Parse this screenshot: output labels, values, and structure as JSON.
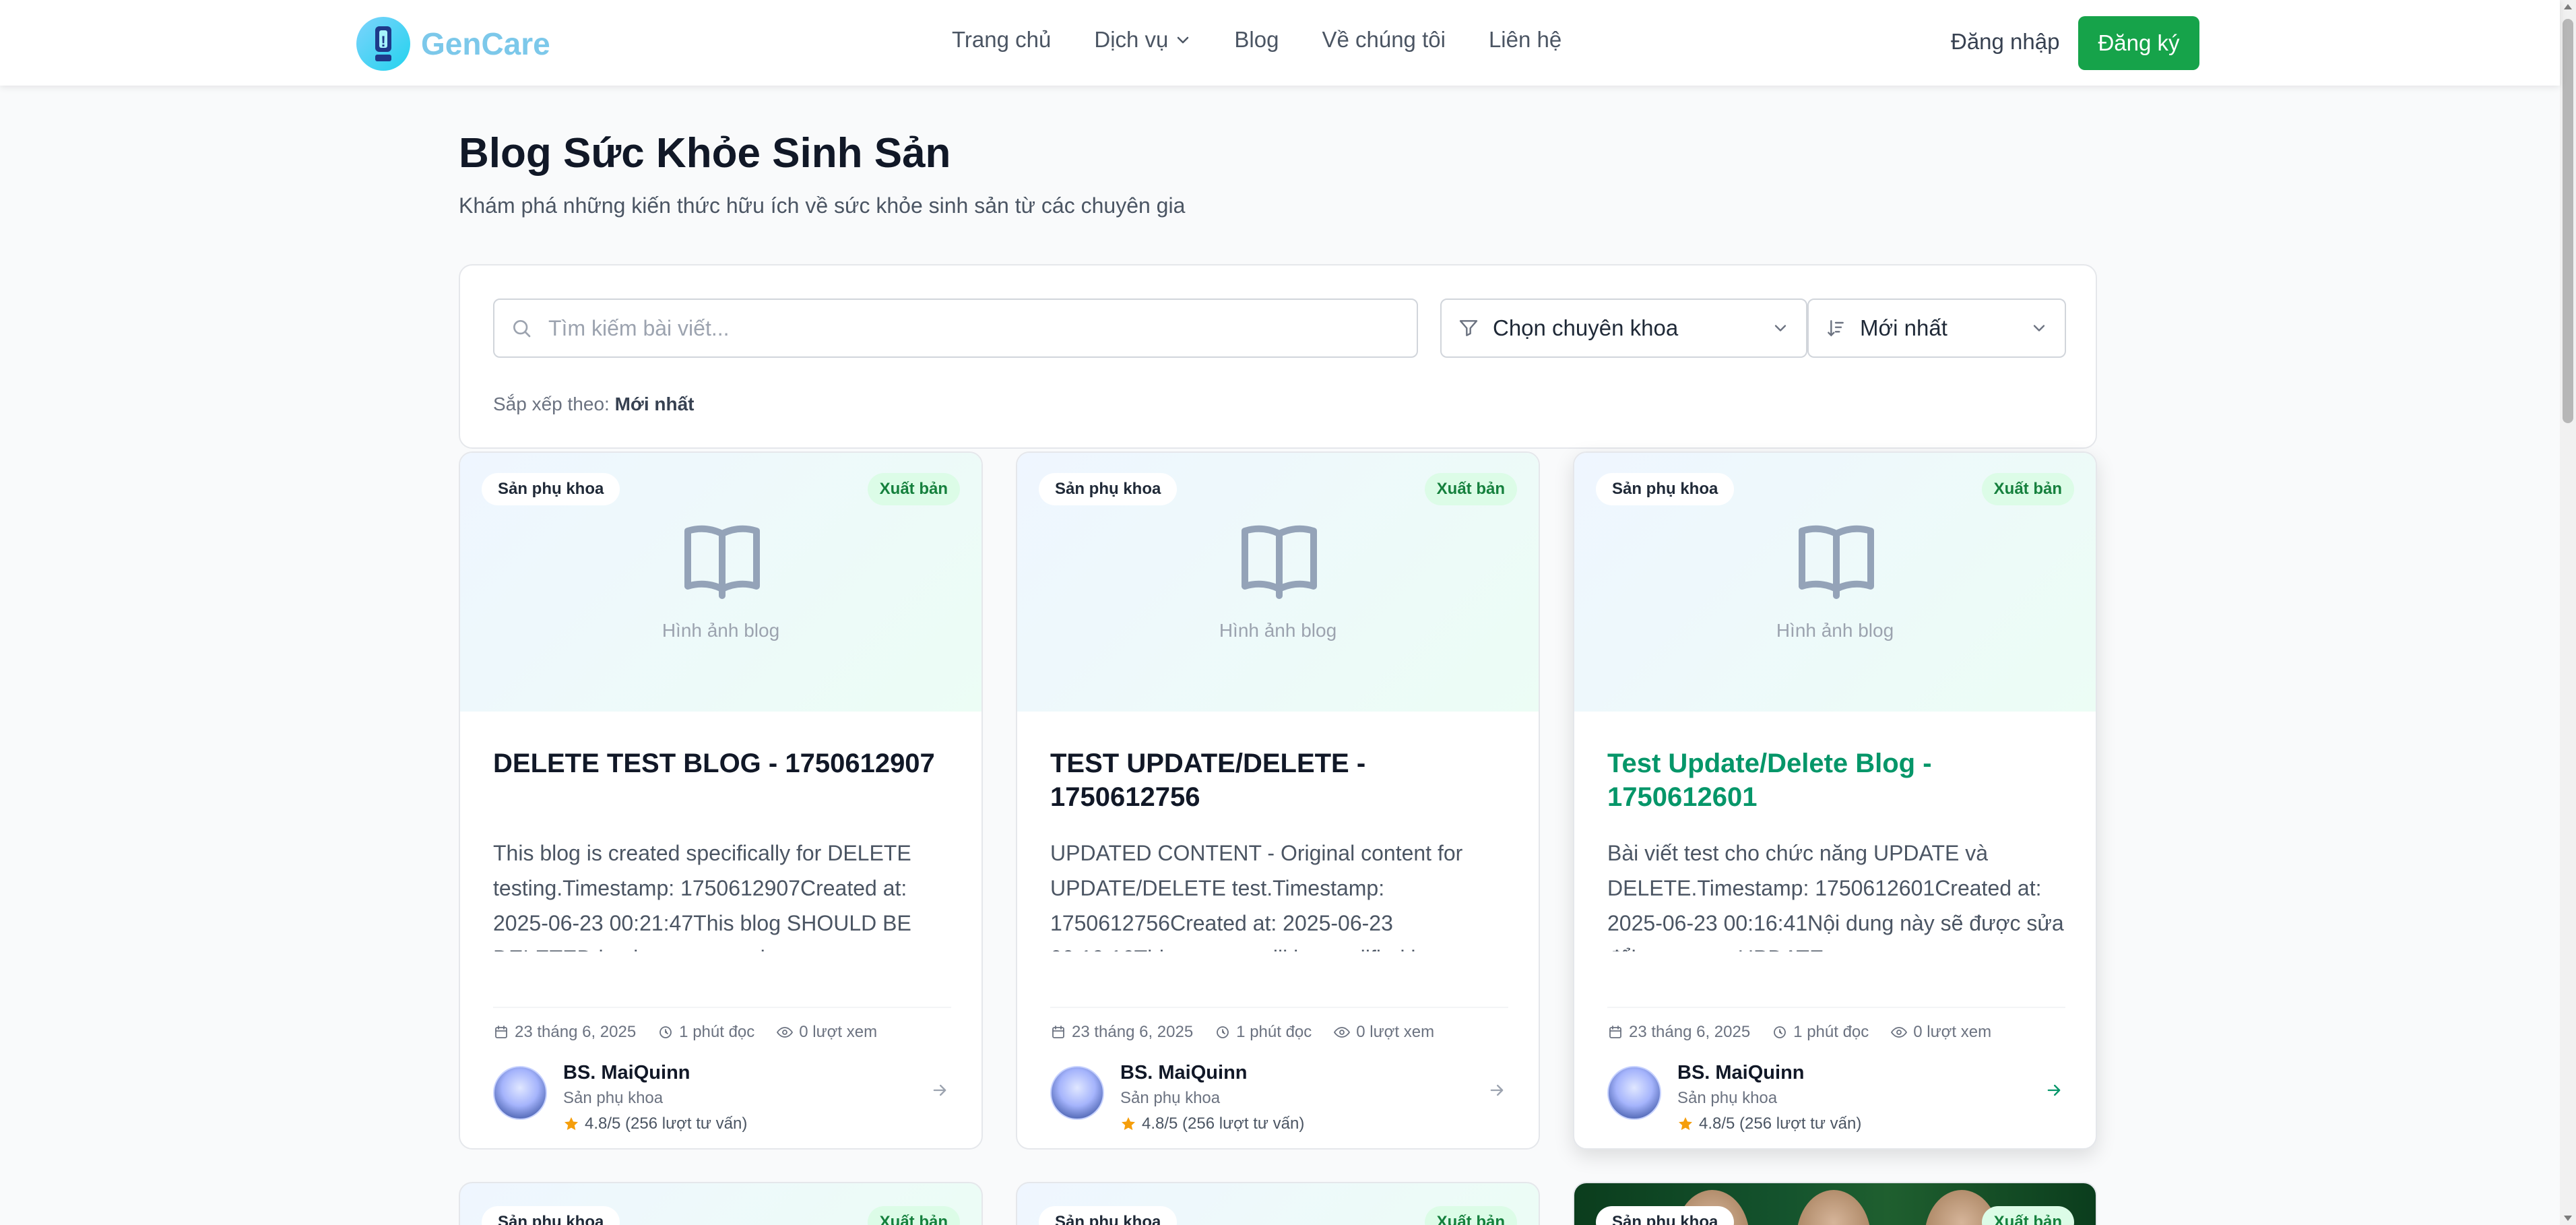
{
  "header": {
    "logo_glyph": "!",
    "brand": "GenCare",
    "nav": [
      "Trang chủ",
      "Dịch vụ",
      "Blog",
      "Về chúng tôi",
      "Liên hệ"
    ],
    "login": "Đăng nhập",
    "signup": "Đăng ký"
  },
  "page": {
    "title": "Blog Sức Khỏe Sinh Sản",
    "subtitle": "Khám phá những kiến thức hữu ích về sức khỏe sinh sản từ các chuyên gia"
  },
  "filters": {
    "search_placeholder": "Tìm kiếm bài viết...",
    "specialty_select": "Chọn chuyên khoa",
    "sort_select": "Mới nhất",
    "sort_note_label": "Sắp xếp theo:",
    "sort_note_value": "Mới nhất"
  },
  "cards": [
    {
      "category": "Sản phụ khoa",
      "status": "Xuất bản",
      "image_caption": "Hình ảnh blog",
      "title": "DELETE TEST BLOG - 1750612907",
      "excerpt": "This blog is created specifically for DELETE testing.Timestamp: 1750612907Created at: 2025-06-23 00:21:47This blog SHOULD BE DELETED by the automated test.",
      "date": "23 tháng 6, 2025",
      "read_time": "1 phút đọc",
      "views": "0 lượt xem",
      "author": "BS. MaiQuinn",
      "author_specialty": "Sản phụ khoa",
      "rating": "4.8/5 (256 lượt tư vấn)"
    },
    {
      "category": "Sản phụ khoa",
      "status": "Xuất bản",
      "image_caption": "Hình ảnh blog",
      "title": "TEST UPDATE/DELETE - 1750612756",
      "excerpt": "UPDATED CONTENT - Original content for UPDATE/DELETE test.Timestamp: 1750612756Created at: 2025-06-23 00:19:16This content will be modified in...",
      "date": "23 tháng 6, 2025",
      "read_time": "1 phút đọc",
      "views": "0 lượt xem",
      "author": "BS. MaiQuinn",
      "author_specialty": "Sản phụ khoa",
      "rating": "4.8/5 (256 lượt tư vấn)"
    },
    {
      "category": "Sản phụ khoa",
      "status": "Xuất bản",
      "image_caption": "Hình ảnh blog",
      "title": "Test Update/Delete Blog - 1750612601",
      "excerpt": "Bài viết test cho chức năng UPDATE và DELETE.Timestamp: 1750612601Created at: 2025-06-23 00:16:41Nội dung này sẽ được sửa đổi trong test UPDATE.",
      "date": "23 tháng 6, 2025",
      "read_time": "1 phút đọc",
      "views": "0 lượt xem",
      "author": "BS. MaiQuinn",
      "author_specialty": "Sản phụ khoa",
      "rating": "4.8/5 (256 lượt tư vấn)"
    }
  ],
  "row2": [
    {
      "category": "Sản phụ khoa",
      "status": "Xuất bản"
    },
    {
      "category": "Sản phụ khoa",
      "status": "Xuất bản"
    },
    {
      "category": "Sản phụ khoa",
      "status": "Xuất bản"
    }
  ],
  "colors": {
    "brand": "#7cc8ea",
    "primary_green": "#16a34a",
    "title_hover": "#059669",
    "star": "#f59e0b"
  }
}
